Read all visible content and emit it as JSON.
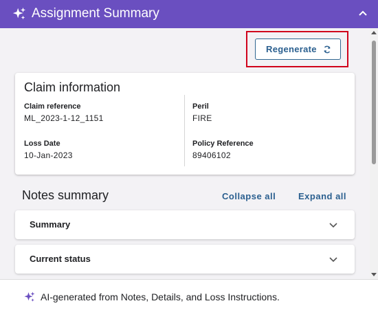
{
  "header": {
    "title": "Assignment Summary"
  },
  "actions": {
    "regenerate_label": "Regenerate"
  },
  "claim": {
    "title": "Claim information",
    "fields": [
      {
        "label": "Claim reference",
        "value": "ML_2023-1-12_1151"
      },
      {
        "label": "Peril",
        "value": "FIRE"
      },
      {
        "label": "Loss Date",
        "value": "10-Jan-2023"
      },
      {
        "label": "Policy Reference",
        "value": "89406102"
      }
    ]
  },
  "notes": {
    "title": "Notes summary",
    "collapse_all": "Collapse all",
    "expand_all": "Expand all",
    "sections": [
      {
        "label": "Summary"
      },
      {
        "label": "Current status"
      }
    ]
  },
  "footer": {
    "text": "AI-generated from Notes, Details, and Loss Instructions."
  },
  "colors": {
    "header": "#6a4fc0",
    "accent": "#2a5f8f",
    "highlight": "#d0021b",
    "panel_bg": "#f3f2f5"
  }
}
